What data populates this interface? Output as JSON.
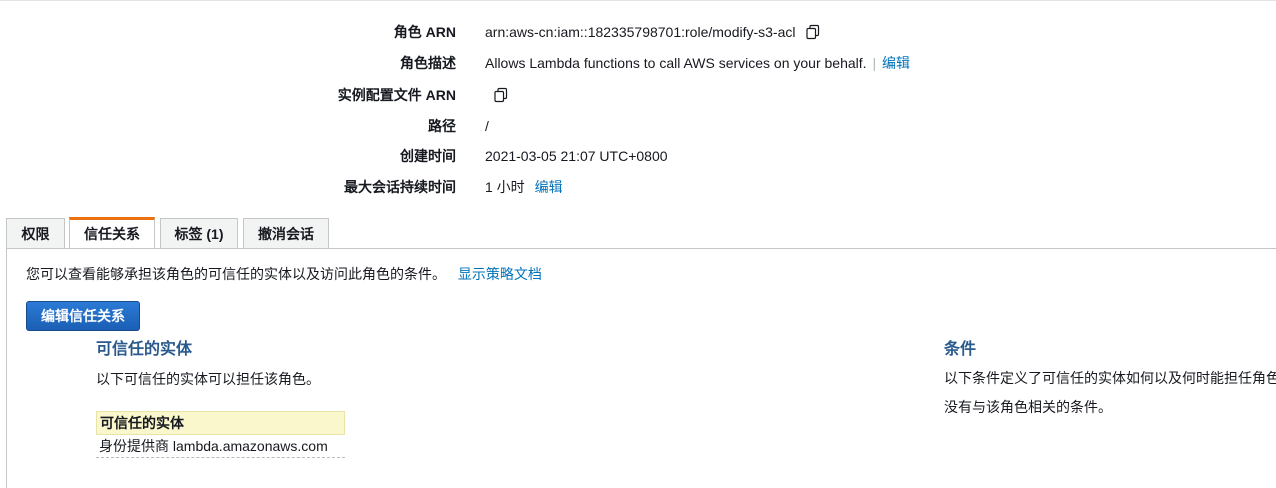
{
  "summary": {
    "role_arn_label": "角色 ARN",
    "role_arn_value": "arn:aws-cn:iam::182335798701:role/modify-s3-acl",
    "role_desc_label": "角色描述",
    "role_desc_value": "Allows Lambda functions to call AWS services on your behalf.",
    "role_desc_sep": "|",
    "role_desc_edit": "编辑",
    "instance_profile_label": "实例配置文件 ARN",
    "path_label": "路径",
    "path_value": "/",
    "created_label": "创建时间",
    "created_value": "2021-03-05 21:07 UTC+0800",
    "max_session_label": "最大会话持续时间",
    "max_session_value": "1 小时",
    "max_session_edit": "编辑"
  },
  "tabs": [
    {
      "label": "权限"
    },
    {
      "label": "信任关系",
      "active": true
    },
    {
      "label": "标签 (1)"
    },
    {
      "label": "撤消会话"
    }
  ],
  "trust": {
    "intro_text": "您可以查看能够承担该角色的可信任的实体以及访问此角色的条件。",
    "intro_link": "显示策略文档",
    "edit_button": "编辑信任关系",
    "entities_title": "可信任的实体",
    "entities_desc": "以下可信任的实体可以担任该角色。",
    "table_header": "可信任的实体",
    "table_rows": [
      "身份提供商 lambda.amazonaws.com"
    ],
    "conditions_title": "条件",
    "conditions_desc": "以下条件定义了可信任的实体如何以及何时能担任角色。",
    "conditions_empty": "没有与该角色相关的条件。"
  },
  "colors": {
    "link": "#0073bb",
    "active_tab_accent": "#ec7211",
    "primary_button": "#1e6bc6",
    "section_title": "#2a5a8c",
    "table_header_bg": "#faf7cc"
  },
  "icons": {
    "copy": "copy-icon"
  }
}
